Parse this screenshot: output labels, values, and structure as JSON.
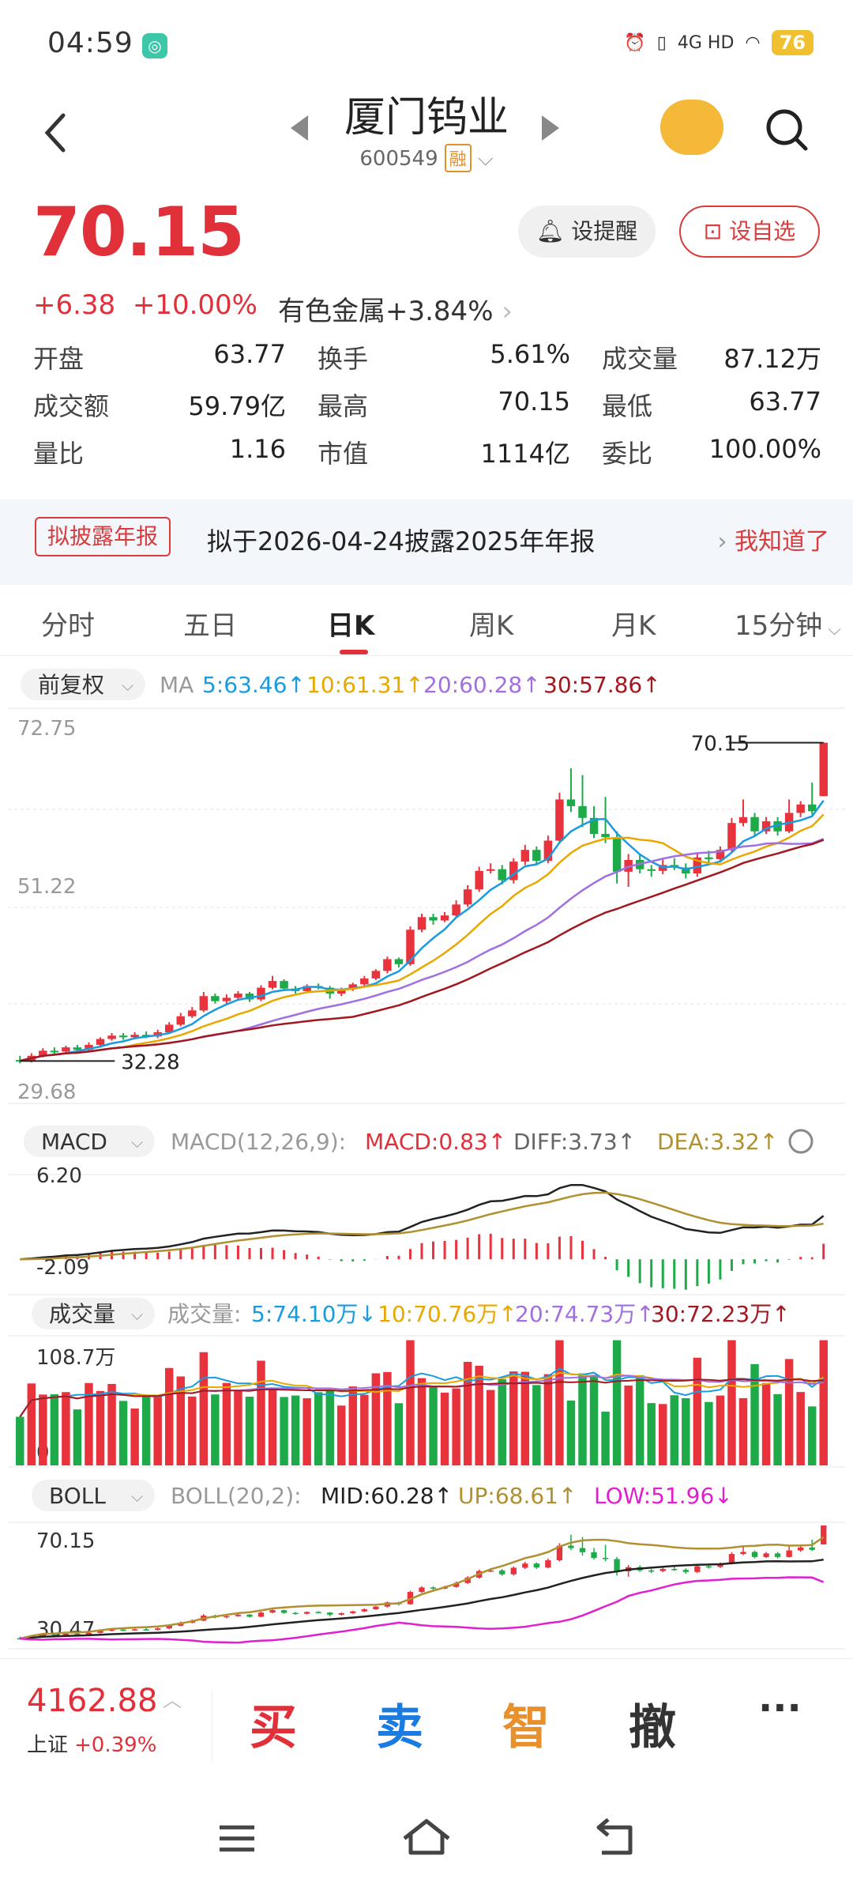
{
  "status": {
    "time": "04:59",
    "network": "4G HD",
    "battery": "76"
  },
  "header": {
    "title": "厦门钨业",
    "code": "600549",
    "badge": "融"
  },
  "quote": {
    "price": "70.15",
    "change": "+6.38",
    "pct": "+10.00%",
    "sector": "有色金属+3.84%",
    "remind_btn": "设提醒",
    "fav_btn": "设自选",
    "fields": [
      [
        {
          "label": "开盘",
          "value": "63.77"
        },
        {
          "label": "换手",
          "value": "5.61%"
        },
        {
          "label": "成交量",
          "value": "87.12万"
        }
      ],
      [
        {
          "label": "成交额",
          "value": "59.79亿"
        },
        {
          "label": "最高",
          "value": "70.15",
          "red": true
        },
        {
          "label": "最低",
          "value": "63.77"
        }
      ],
      [
        {
          "label": "量比",
          "value": "1.16"
        },
        {
          "label": "市值",
          "value": "1114亿"
        },
        {
          "label": "委比",
          "value": "100.00%",
          "red": true
        }
      ]
    ]
  },
  "notice": {
    "tag": "拟披露年报",
    "text": "拟于2026-04-24披露2025年年报",
    "ack": "我知道了"
  },
  "tabs": [
    "分时",
    "五日",
    "日K",
    "周K",
    "月K",
    "15分钟"
  ],
  "ma_bar": {
    "adjust": "前复权",
    "prefix": "MA",
    "ma5": "5:63.46↑",
    "ma10": "10:61.31↑",
    "ma20": "20:60.28↑",
    "ma30": "30:57.86↑"
  },
  "macd_bar": {
    "name": "MACD",
    "params": "MACD(12,26,9):",
    "macd": "MACD:0.83↑",
    "diff": "DIFF:3.73↑",
    "dea": "DEA:3.32↑"
  },
  "vol_bar": {
    "name": "成交量",
    "prefix": "成交量:",
    "v5": "5:74.10万↓",
    "v10": "10:70.76万↑",
    "v20": "20:74.73万↑",
    "v30": "30:72.23万↑"
  },
  "boll_bar": {
    "name": "BOLL",
    "params": "BOLL(20,2):",
    "mid": "MID:60.28↑",
    "up": "UP:68.61↑",
    "low": "LOW:51.96↓"
  },
  "colors": {
    "up": "#e8323c",
    "down": "#1faa4a",
    "ma5": "#1a9be0",
    "ma10": "#e8a800",
    "ma20": "#a070e0",
    "ma30": "#a01820",
    "diff": "#222222",
    "dea": "#b09030",
    "boll_mid": "#222222",
    "boll_up": "#b09030",
    "boll_low": "#e020d0"
  },
  "chart_data": {
    "type": "candlestick",
    "kline": {
      "ylabels": [
        "72.75",
        "51.22",
        "29.68"
      ],
      "ylim": [
        29.68,
        72.75
      ],
      "annot_high": "70.15",
      "annot_low": "32.28",
      "candles": [
        [
          32.4,
          32.3,
          32.9,
          32.0
        ],
        [
          32.3,
          32.9,
          33.2,
          32.1
        ],
        [
          32.9,
          33.5,
          33.8,
          32.7
        ],
        [
          33.5,
          33.4,
          33.9,
          33.1
        ],
        [
          33.4,
          33.9,
          34.1,
          33.2
        ],
        [
          33.9,
          33.6,
          34.2,
          33.4
        ],
        [
          33.6,
          34.2,
          34.5,
          33.4
        ],
        [
          34.2,
          34.9,
          35.1,
          34.0
        ],
        [
          34.9,
          35.3,
          35.6,
          34.7
        ],
        [
          35.3,
          35.1,
          35.6,
          34.8
        ],
        [
          35.1,
          35.4,
          35.7,
          34.9
        ],
        [
          35.4,
          35.2,
          35.8,
          35.0
        ],
        [
          35.2,
          35.7,
          36.0,
          35.0
        ],
        [
          35.7,
          36.6,
          36.9,
          35.5
        ],
        [
          36.6,
          37.6,
          38.0,
          36.4
        ],
        [
          37.6,
          38.3,
          38.7,
          37.4
        ],
        [
          38.3,
          40.0,
          40.5,
          38.1
        ],
        [
          40.0,
          39.4,
          40.3,
          39.1
        ],
        [
          39.4,
          39.8,
          40.2,
          39.1
        ],
        [
          39.8,
          40.3,
          40.6,
          39.6
        ],
        [
          40.3,
          39.6,
          40.5,
          39.3
        ],
        [
          39.6,
          41.0,
          41.3,
          39.4
        ],
        [
          41.0,
          41.8,
          42.4,
          40.8
        ],
        [
          41.8,
          40.9,
          42.0,
          40.6
        ],
        [
          40.9,
          40.6,
          41.2,
          40.3
        ],
        [
          40.6,
          41.2,
          41.4,
          40.4
        ],
        [
          41.2,
          41.0,
          41.5,
          40.8
        ],
        [
          41.0,
          40.3,
          41.2,
          39.7
        ],
        [
          40.3,
          40.8,
          41.0,
          40.0
        ],
        [
          40.8,
          41.4,
          41.6,
          40.6
        ],
        [
          41.4,
          42.1,
          42.4,
          41.1
        ],
        [
          42.1,
          43.0,
          43.2,
          41.9
        ],
        [
          43.0,
          44.4,
          44.7,
          42.7
        ],
        [
          44.4,
          43.8,
          44.6,
          43.4
        ],
        [
          43.8,
          47.9,
          48.3,
          43.6
        ],
        [
          47.9,
          49.4,
          49.8,
          47.6
        ],
        [
          49.4,
          49.0,
          49.8,
          48.5
        ],
        [
          49.0,
          49.6,
          50.0,
          48.8
        ],
        [
          49.6,
          50.9,
          51.4,
          49.3
        ],
        [
          50.9,
          52.7,
          53.2,
          50.6
        ],
        [
          52.7,
          54.9,
          55.4,
          52.4
        ],
        [
          54.9,
          55.1,
          55.8,
          54.6
        ],
        [
          55.1,
          53.8,
          55.6,
          53.3
        ],
        [
          53.8,
          56.0,
          56.4,
          53.4
        ],
        [
          56.0,
          57.4,
          58.0,
          55.6
        ],
        [
          57.4,
          56.1,
          57.8,
          55.6
        ],
        [
          56.1,
          58.5,
          59.1,
          55.8
        ],
        [
          58.5,
          63.4,
          64.2,
          58.1
        ],
        [
          63.4,
          62.6,
          67.1,
          61.9
        ],
        [
          62.6,
          61.2,
          66.3,
          60.1
        ],
        [
          61.2,
          59.3,
          62.6,
          58.8
        ],
        [
          59.3,
          58.9,
          63.7,
          58.2
        ],
        [
          58.9,
          54.8,
          59.6,
          53.4
        ],
        [
          54.8,
          56.2,
          56.9,
          53.0
        ],
        [
          56.2,
          55.1,
          56.8,
          54.6
        ],
        [
          55.1,
          54.9,
          55.6,
          54.2
        ],
        [
          54.9,
          55.6,
          56.3,
          54.5
        ],
        [
          55.6,
          55.3,
          56.4,
          55.0
        ],
        [
          55.3,
          54.6,
          55.8,
          54.0
        ],
        [
          54.6,
          56.5,
          57.1,
          54.2
        ],
        [
          56.5,
          56.3,
          57.3,
          55.7
        ],
        [
          56.3,
          57.4,
          57.8,
          55.9
        ],
        [
          57.4,
          60.6,
          61.2,
          57.1
        ],
        [
          60.6,
          61.3,
          63.4,
          60.2
        ],
        [
          61.3,
          59.6,
          61.8,
          59.1
        ],
        [
          59.6,
          60.8,
          61.3,
          59.3
        ],
        [
          60.8,
          59.6,
          61.3,
          59.1
        ],
        [
          59.6,
          61.8,
          63.4,
          59.4
        ],
        [
          61.8,
          62.8,
          63.2,
          61.3
        ],
        [
          62.8,
          62.0,
          65.4,
          61.6
        ],
        [
          63.8,
          70.15,
          70.15,
          63.77
        ]
      ]
    },
    "macd": {
      "ylabels": [
        "6.20",
        "-2.09"
      ],
      "ylim": [
        -2.09,
        6.2
      ]
    },
    "volume": {
      "ylabels": [
        "108.7万",
        "0"
      ],
      "ylim": [
        0,
        108.7
      ]
    },
    "boll": {
      "ylabels": [
        "70.15",
        "30.47"
      ],
      "ylim": [
        30.47,
        70.15
      ]
    }
  },
  "bottom": {
    "index_value": "4162.88",
    "index_name": "上证",
    "index_pct": "+0.39%",
    "buy": "买",
    "sell": "卖",
    "smart": "智",
    "cancel": "撤",
    "more": "···"
  }
}
